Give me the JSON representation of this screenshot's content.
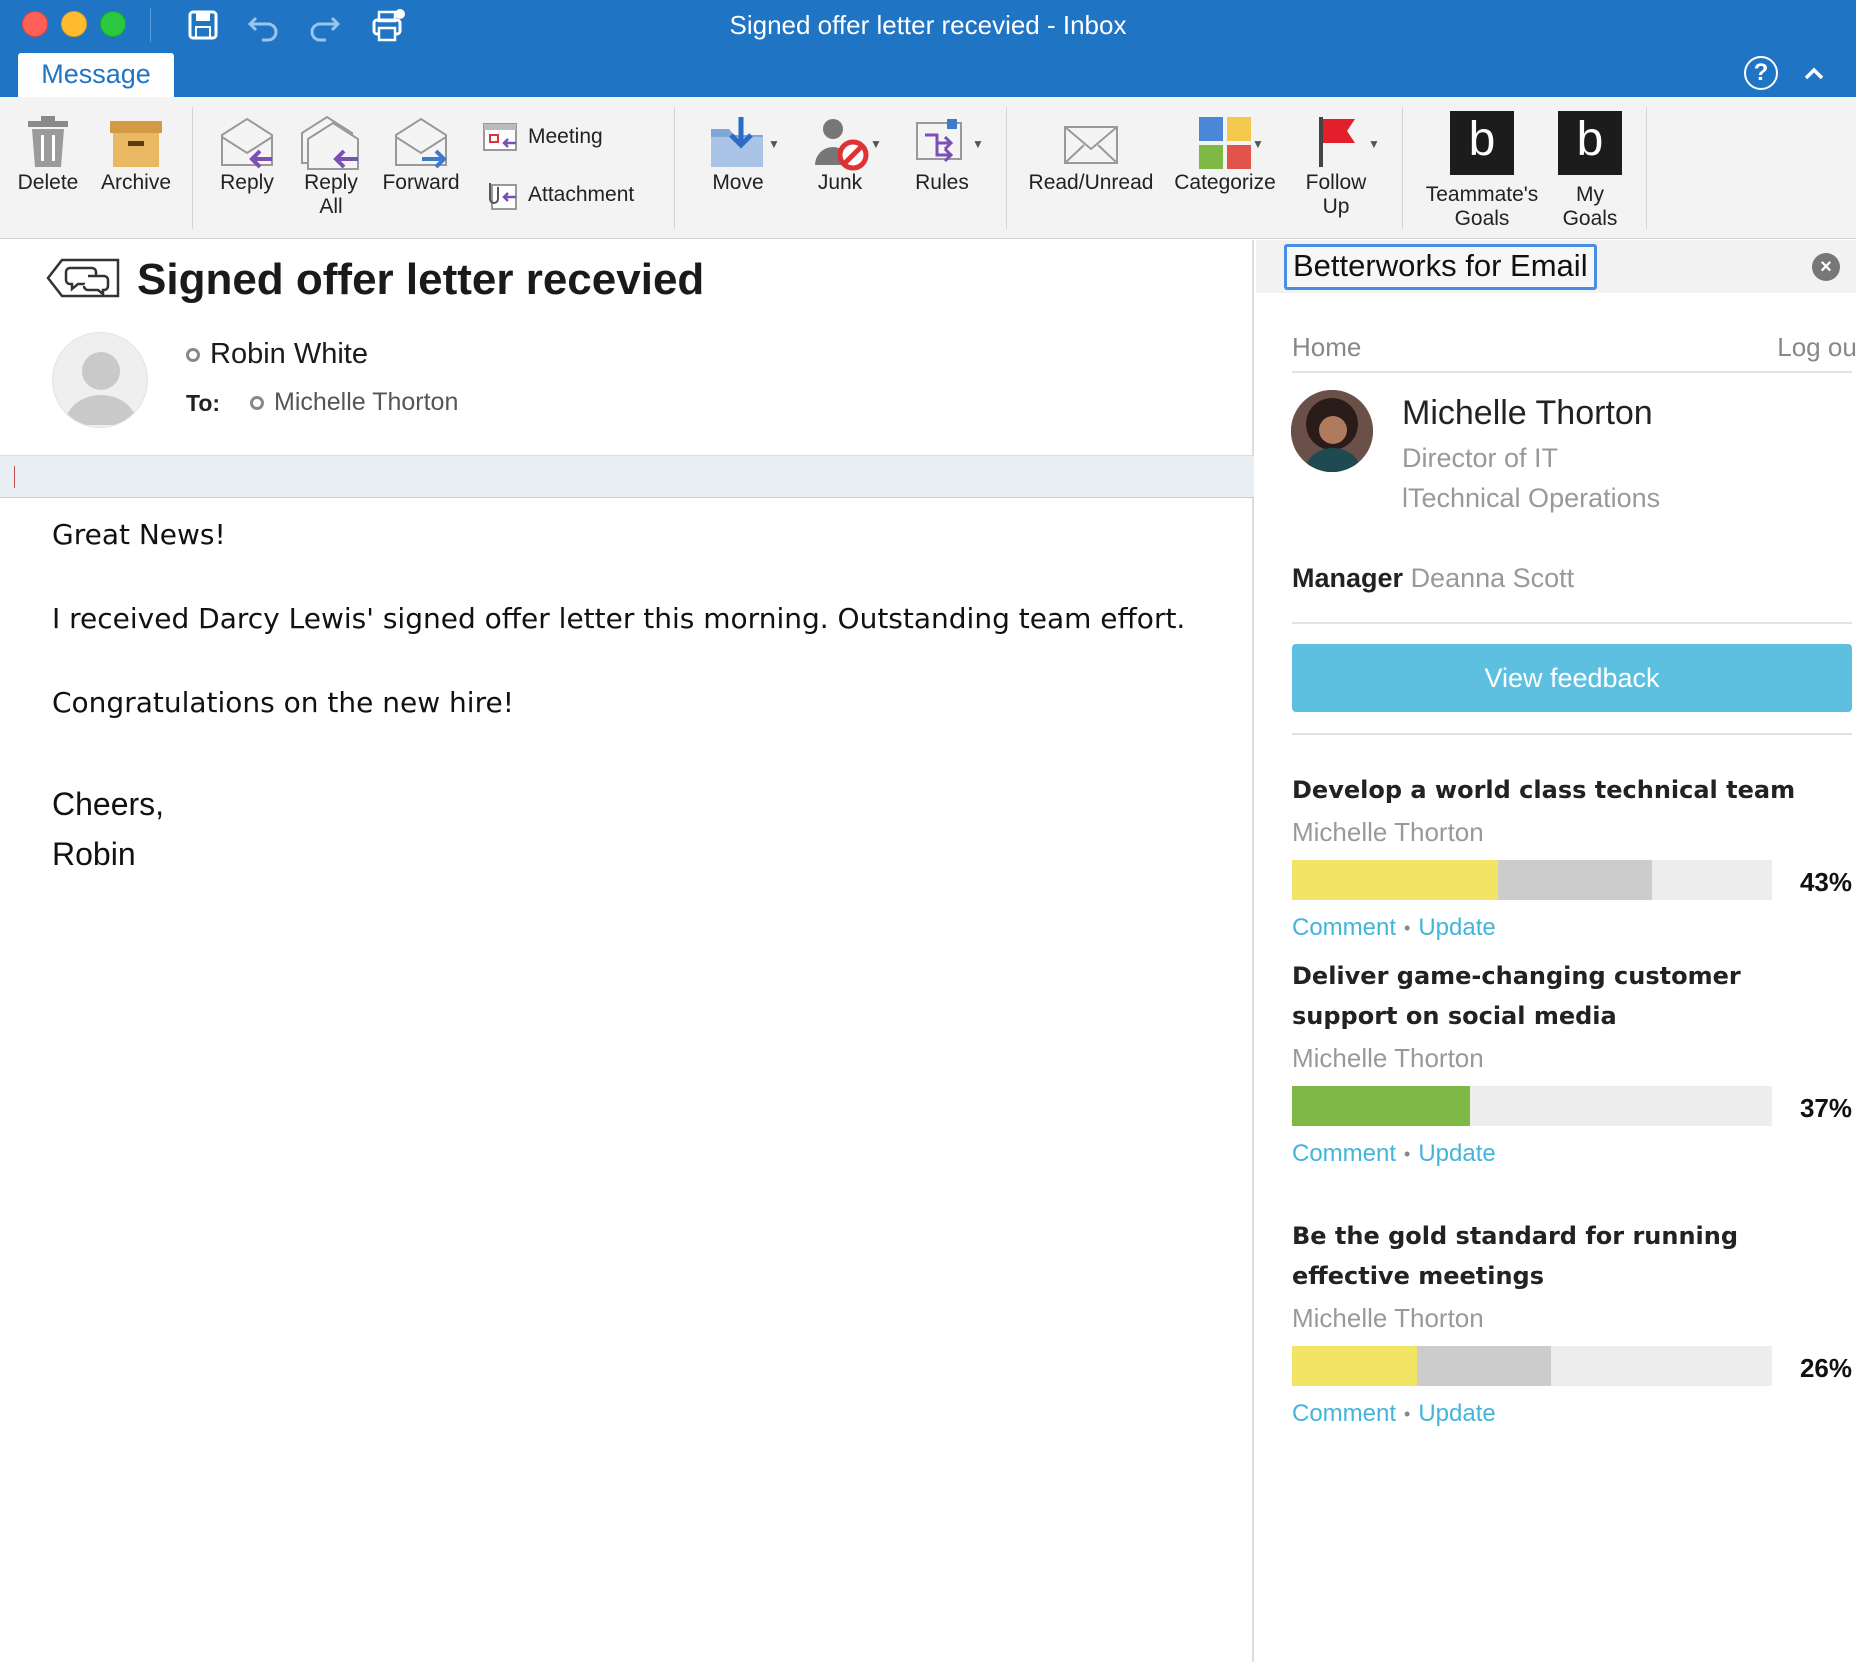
{
  "window": {
    "title": "Signed offer letter recevied - Inbox"
  },
  "tabs": {
    "message": "Message"
  },
  "ribbon": {
    "delete": "Delete",
    "archive": "Archive",
    "reply": "Reply",
    "reply_all_1": "Reply",
    "reply_all_2": "All",
    "forward": "Forward",
    "meeting": "Meeting",
    "attachment": "Attachment",
    "move": "Move",
    "junk": "Junk",
    "rules": "Rules",
    "read_unread": "Read/Unread",
    "categorize": "Categorize",
    "follow_up_1": "Follow",
    "follow_up_2": "Up",
    "teammates_goals_1": "Teammate's",
    "teammates_goals_2": "Goals",
    "my_goals_1": "My",
    "my_goals_2": "Goals",
    "bw_glyph": "b"
  },
  "email": {
    "subject": "Signed offer letter recevied",
    "sender": "Robin White",
    "to_label": "To:",
    "to_value": "Michelle Thorton",
    "body": {
      "line1": "Great News!",
      "line2": "I received Darcy Lewis' signed offer letter this morning. Outstanding team effort.",
      "line3": "Congratulations on the new hire!",
      "line4": "Cheers,",
      "line5": "Robin"
    }
  },
  "sidebar": {
    "title": "Betterworks for Email",
    "close": "×",
    "nav": {
      "home": "Home",
      "logout": "Log out"
    },
    "profile": {
      "name": "Michelle Thorton",
      "role": "Director of IT",
      "dept": "lTechnical Operations"
    },
    "manager_label": "Manager",
    "manager_name": "Deanna Scott",
    "feedback_button": "View feedback",
    "goals": [
      {
        "title": "Develop a world class technical team",
        "owner": "Michelle Thorton",
        "percent_label": "43%",
        "progress": 0.43,
        "secondary": 0.75,
        "color": "#f2e464",
        "comment": "Comment",
        "update": "Update"
      },
      {
        "title": "Deliver game-changing customer support on social media",
        "owner": "Michelle Thorton",
        "percent_label": "37%",
        "progress": 0.37,
        "secondary": 0.37,
        "color": "#7db944",
        "comment": "Comment",
        "update": "Update"
      },
      {
        "title": "Be the gold standard for running effective meetings",
        "owner": "Michelle Thorton",
        "percent_label": "26%",
        "progress": 0.26,
        "secondary": 0.54,
        "color": "#f2e464",
        "comment": "Comment",
        "update": "Update"
      }
    ]
  }
}
